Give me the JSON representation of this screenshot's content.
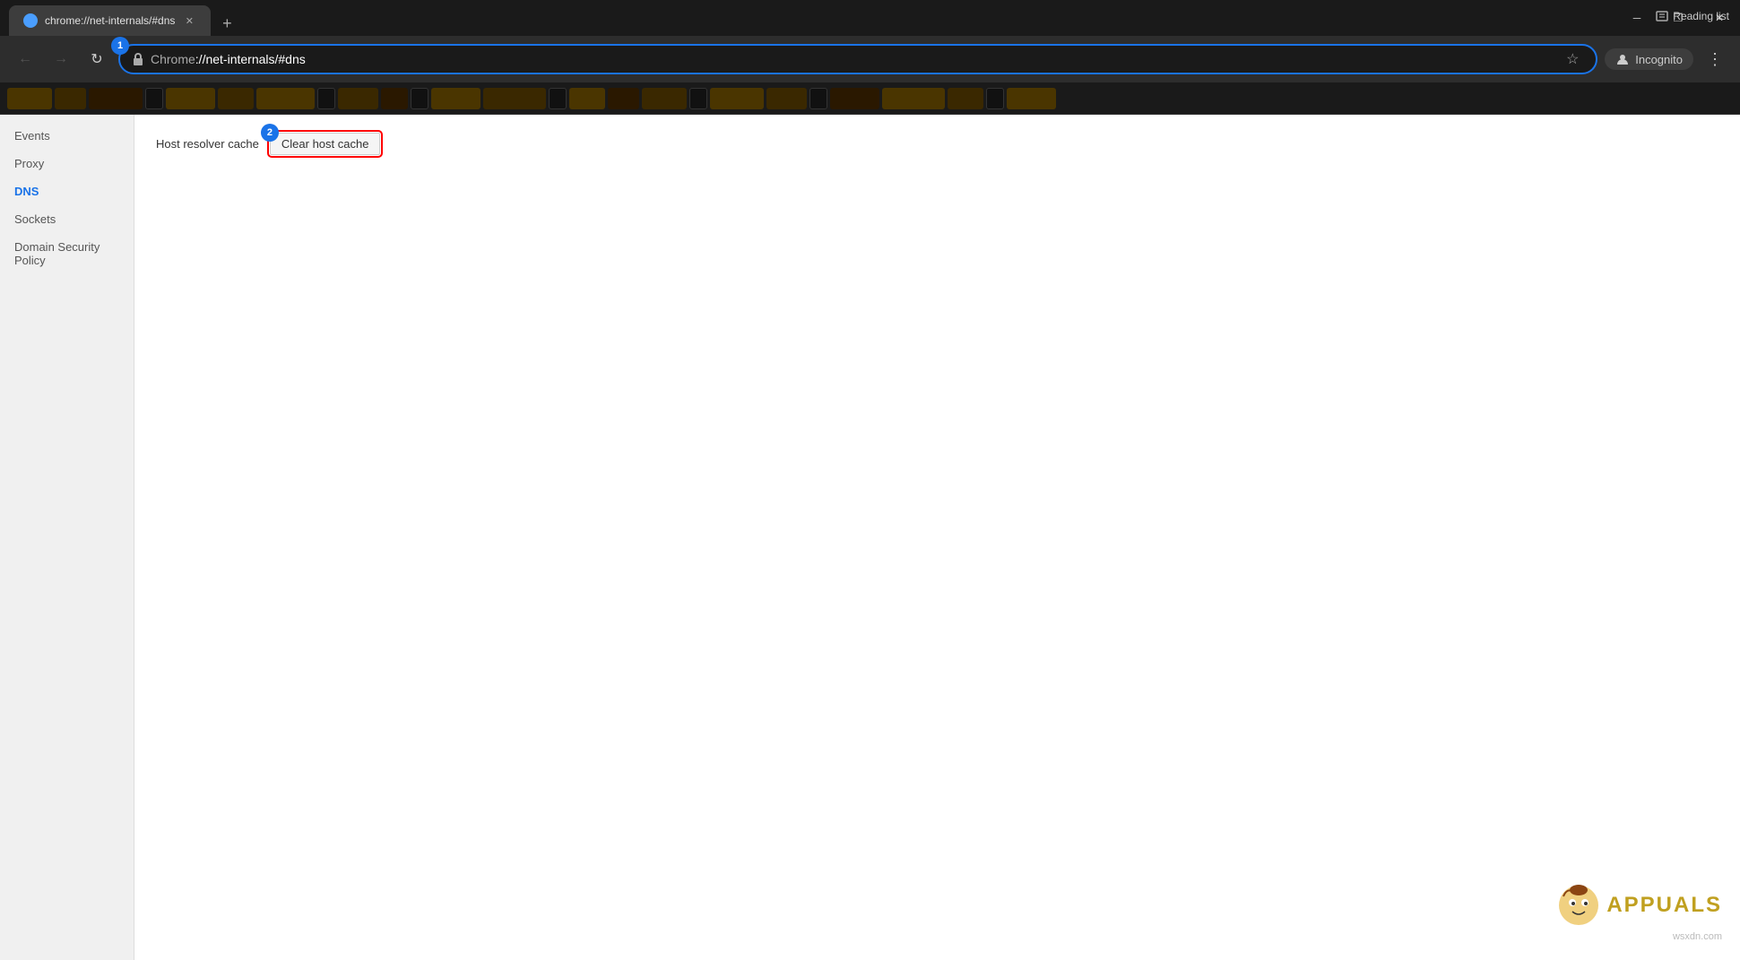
{
  "titlebar": {
    "tab_title": "chrome://net-internals/#dns",
    "tab_favicon": "●",
    "close_label": "✕",
    "new_tab_label": "+",
    "minimize_label": "─",
    "maximize_label": "❐",
    "close_win_label": "✕"
  },
  "addressbar": {
    "back_label": "←",
    "forward_label": "→",
    "refresh_label": "↻",
    "url_prefix": "Chrome",
    "url_main": "://net-internals/#dns",
    "star_label": "☆",
    "incognito_label": "Incognito",
    "menu_label": "⋮",
    "step1_badge": "1"
  },
  "bookmarks": {
    "reading_list_label": "Reading list",
    "items": []
  },
  "sidebar": {
    "items": [
      {
        "label": "Events",
        "active": false
      },
      {
        "label": "Proxy",
        "active": false
      },
      {
        "label": "DNS",
        "active": true
      },
      {
        "label": "Sockets",
        "active": false
      },
      {
        "label": "Domain Security Policy",
        "active": false
      }
    ]
  },
  "content": {
    "host_resolver_label": "Host resolver cache",
    "clear_cache_button_label": "Clear host cache",
    "step2_badge": "2"
  },
  "watermark": {
    "text": "wsxdn.com"
  },
  "appuals": {
    "text": "APPUALS"
  }
}
